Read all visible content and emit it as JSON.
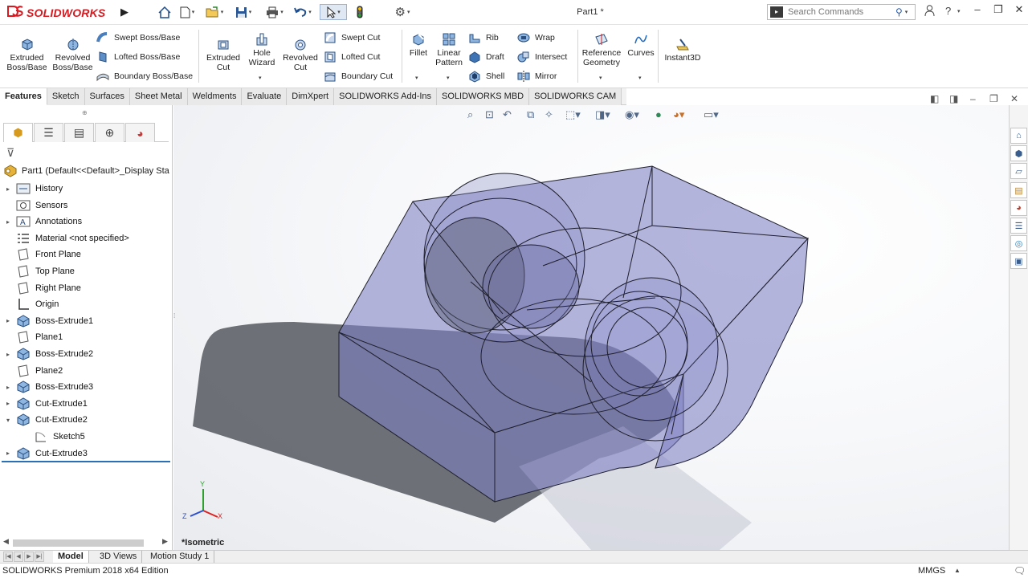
{
  "app": {
    "logo_text": "SOLIDWORKS",
    "doc_title": "Part1 *",
    "search_placeholder": "Search Commands"
  },
  "quick_access": [
    "home-icon",
    "new-document-icon",
    "open-icon",
    "save-icon",
    "print-icon",
    "undo-icon",
    "select-icon",
    "rebuild-icon",
    "options-icon"
  ],
  "ribbon": {
    "extruded_boss": "Extruded\nBoss/Base",
    "revolved_boss": "Revolved\nBoss/Base",
    "swept_boss": "Swept Boss/Base",
    "lofted_boss": "Lofted Boss/Base",
    "boundary_boss": "Boundary Boss/Base",
    "extruded_cut": "Extruded\nCut",
    "hole_wizard": "Hole\nWizard",
    "revolved_cut": "Revolved\nCut",
    "swept_cut": "Swept Cut",
    "lofted_cut": "Lofted Cut",
    "boundary_cut": "Boundary Cut",
    "fillet": "Fillet",
    "linear_pattern": "Linear\nPattern",
    "rib": "Rib",
    "draft": "Draft",
    "shell": "Shell",
    "wrap": "Wrap",
    "intersect": "Intersect",
    "mirror": "Mirror",
    "reference_geometry": "Reference\nGeometry",
    "curves": "Curves",
    "instant3d": "Instant3D"
  },
  "command_tabs": [
    "Features",
    "Sketch",
    "Surfaces",
    "Sheet Metal",
    "Weldments",
    "Evaluate",
    "DimXpert",
    "SOLIDWORKS Add-Ins",
    "SOLIDWORKS MBD",
    "SOLIDWORKS CAM"
  ],
  "feature_tree": {
    "root": "Part1  (Default<<Default>_Display Sta",
    "items": [
      {
        "label": "History",
        "expand": "▸"
      },
      {
        "label": "Sensors",
        "expand": ""
      },
      {
        "label": "Annotations",
        "expand": "▸"
      },
      {
        "label": "Material <not specified>",
        "expand": ""
      },
      {
        "label": "Front Plane",
        "expand": ""
      },
      {
        "label": "Top Plane",
        "expand": ""
      },
      {
        "label": "Right Plane",
        "expand": ""
      },
      {
        "label": "Origin",
        "expand": ""
      },
      {
        "label": "Boss-Extrude1",
        "expand": "▸"
      },
      {
        "label": "Plane1",
        "expand": ""
      },
      {
        "label": "Boss-Extrude2",
        "expand": "▸"
      },
      {
        "label": "Plane2",
        "expand": ""
      },
      {
        "label": "Boss-Extrude3",
        "expand": "▸"
      },
      {
        "label": "Cut-Extrude1",
        "expand": "▸"
      },
      {
        "label": "Cut-Extrude2",
        "expand": "▾"
      },
      {
        "label": "Sketch5",
        "expand": ""
      },
      {
        "label": "Cut-Extrude3",
        "expand": "▸"
      }
    ]
  },
  "viewport": {
    "view_label": "*Isometric",
    "triad": {
      "x": "X",
      "y": "Y",
      "z": "Z"
    }
  },
  "bottom_tabs": [
    "Model",
    "3D Views",
    "Motion Study 1"
  ],
  "status": {
    "edition": "SOLIDWORKS Premium 2018 x64 Edition",
    "units": "MMGS"
  },
  "colors": {
    "part_fill": "#7d80c2",
    "part_edge": "#1e1f2c",
    "accent": "#2b6fb5",
    "logo_red": "#d71920"
  }
}
